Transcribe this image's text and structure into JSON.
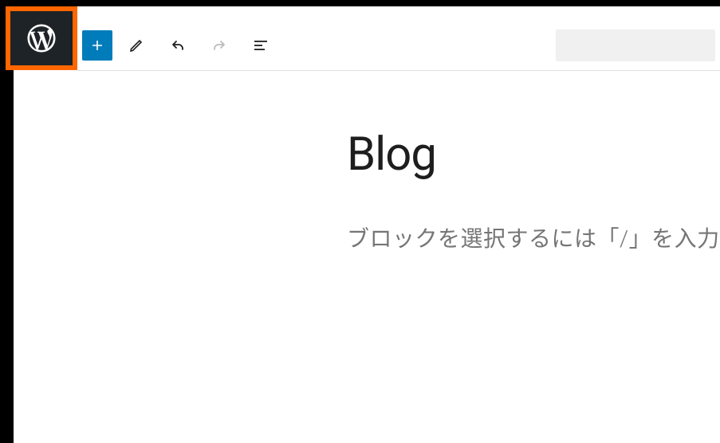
{
  "logo": {
    "name": "wordpress-logo"
  },
  "toolbar": {
    "add_label": "Add block",
    "tools_label": "Tools",
    "undo_label": "Undo",
    "redo_label": "Redo",
    "outline_label": "Document outline"
  },
  "editor": {
    "title": "Blog",
    "placeholder": "ブロックを選択するには「/」を入力"
  }
}
